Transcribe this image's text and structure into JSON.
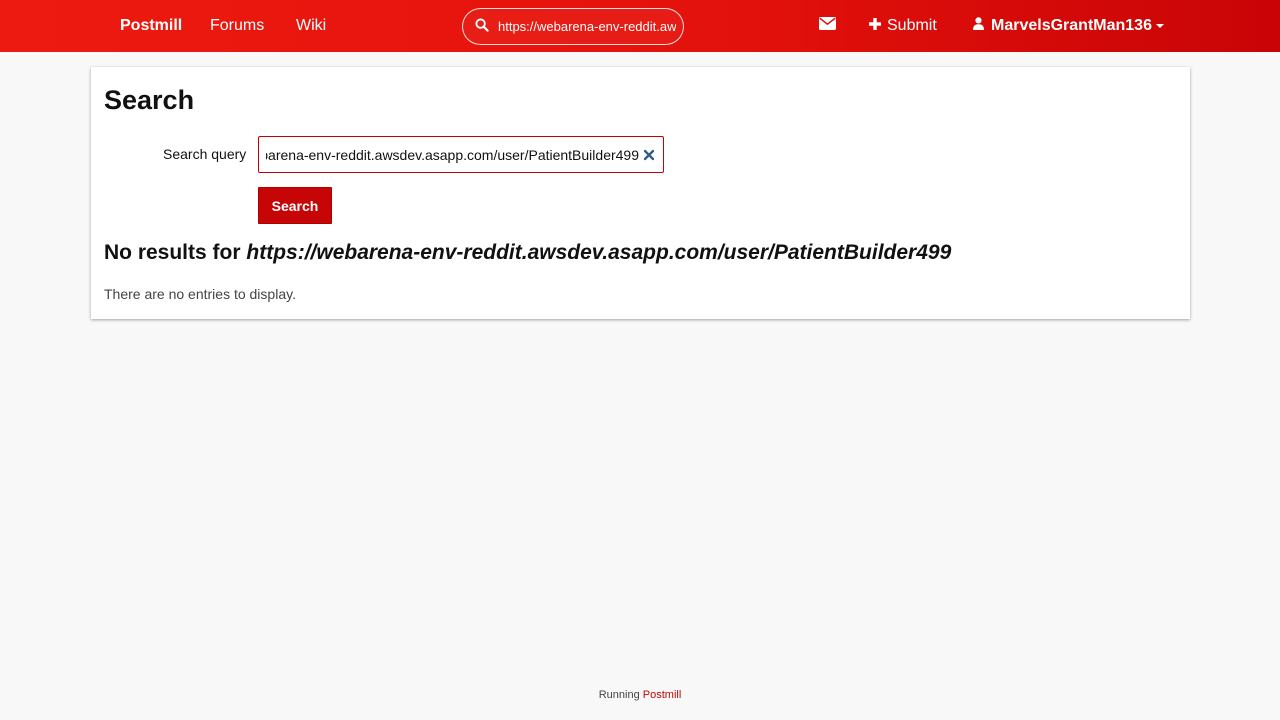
{
  "navbar": {
    "brand": "Postmill",
    "links": [
      "Forums",
      "Wiki"
    ],
    "search_value": "https://webarena-env-reddit.awsdev.asapp.com/user/PatientBuilder499",
    "submit_label": "Submit",
    "username": "MarvelsGrantMan136",
    "icons": {
      "search": "search-icon",
      "mail": "envelope-icon",
      "submit": "plus-icon",
      "user": "user-icon"
    }
  },
  "main": {
    "title": "Search",
    "query_label": "Search query",
    "query_value": "https://webarena-env-reddit.awsdev.asapp.com/user/PatientBuilder499",
    "search_button": "Search",
    "no_results_prefix": "No results for",
    "no_results_query": "https://webarena-env-reddit.awsdev.asapp.com/user/PatientBuilder499",
    "no_entries": "There are no entries to display."
  },
  "footer": {
    "prefix": "Running",
    "link": "Postmill"
  },
  "colors": {
    "brand_red": "#e4120c",
    "accent_red": "#c60606",
    "background": "#f8f8f8"
  }
}
